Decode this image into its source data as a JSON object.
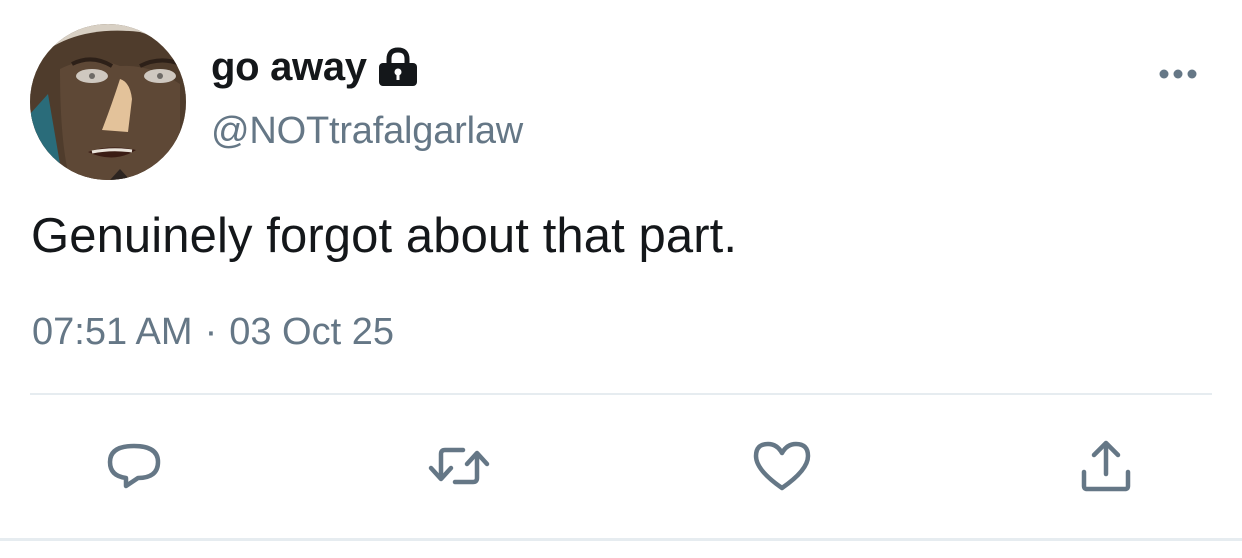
{
  "author": {
    "display_name": "go away",
    "handle": "@NOTtrafalgarlaw",
    "protected_icon": "lock-icon",
    "avatar_icon": "avatar"
  },
  "tweet": {
    "text": "Genuinely forgot about that part.",
    "time": "07:51 AM",
    "separator": "·",
    "date": "03 Oct 25"
  },
  "actions": {
    "reply_icon": "reply-icon",
    "retweet_icon": "retweet-icon",
    "like_icon": "heart-icon",
    "share_icon": "share-icon",
    "more_icon": "more-options-icon"
  },
  "colors": {
    "text_primary": "#14171a",
    "text_secondary": "#657786",
    "divider": "#e6ecf0"
  }
}
